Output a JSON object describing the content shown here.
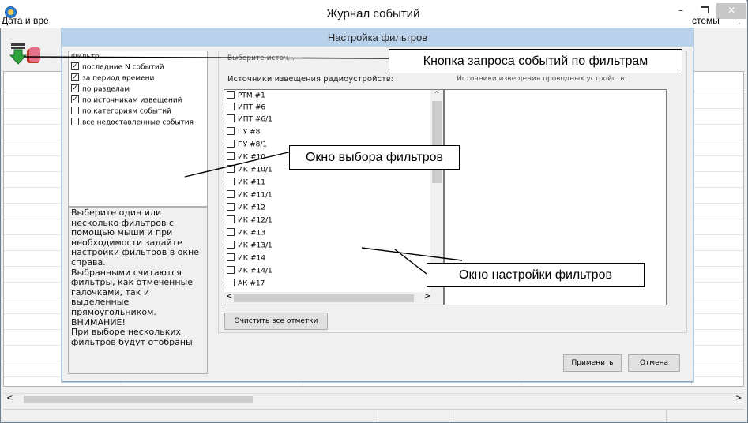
{
  "window": {
    "title": "Журнал событий",
    "minimize": "–",
    "close": "✕"
  },
  "grid": {
    "col_date": "Дата и вре",
    "col_right": "стемы",
    "col_right_tail": ","
  },
  "scroll": {
    "left": "<",
    "right": ">"
  },
  "dialog": {
    "title": "Настройка фильтров",
    "filter_group_label": "Фильтр",
    "filters": [
      {
        "label": "последние N событий",
        "checked": true
      },
      {
        "label": "за период времени",
        "checked": true
      },
      {
        "label": "по разделам",
        "checked": true
      },
      {
        "label": "по источникам извещений",
        "checked": true
      },
      {
        "label": "по категориям событий",
        "checked": false
      },
      {
        "label": "все недоставленные события",
        "checked": false
      }
    ],
    "help_text": "Выберите один или\nнесколько фильтров с\nпомощью мыши и при\nнеобходимости задайте\nнастройки фильтров в окне\nсправа.\nВыбранными считаются\nфильтры, как отмеченные\nгалочками, так и\nвыделенные\nпрямоугольником.\nВНИМАНИЕ!\nПри выборе нескольких\nфильтров будут отобраны",
    "hidden_header": "Выберите источ...",
    "radio_header": "Источники извещения радиоустройств:",
    "wired_header": "Источники извещения проводных устройств:",
    "radio_sources": [
      "РТМ #1",
      "ИПТ #6",
      "ИПТ #6/1",
      "ПУ #8",
      "ПУ #8/1",
      "ИК #10",
      "ИК #10/1",
      "ИК #11",
      "ИК #11/1",
      "ИК #12",
      "ИК #12/1",
      "ИК #13",
      "ИК #13/1",
      "ИК #14",
      "ИК #14/1",
      "АК #17"
    ],
    "scroll_up": "^",
    "clear_button": "Очистить все отметки",
    "apply_button": "Применить",
    "cancel_button": "Отмена"
  },
  "callouts": {
    "request": "Кнопка запроса событий по фильтрам",
    "filter_window": "Окно выбора фильтров",
    "settings_window": "Окно настройки фильтров"
  }
}
